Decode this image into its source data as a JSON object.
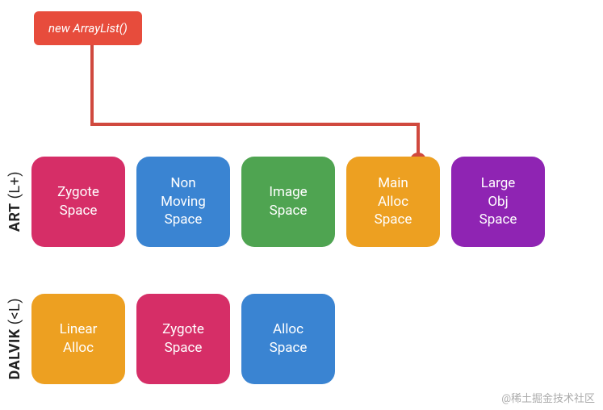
{
  "callout": {
    "text": "new ArrayList()"
  },
  "rows": {
    "art": {
      "label_main": "ART",
      "label_sub": "(L+)",
      "boxes": [
        {
          "label": "Zygote\nSpace",
          "color": "pink"
        },
        {
          "label": "Non\nMoving\nSpace",
          "color": "blue"
        },
        {
          "label": "Image\nSpace",
          "color": "green"
        },
        {
          "label": "Main\nAlloc\nSpace",
          "color": "orange"
        },
        {
          "label": "Large\nObj\nSpace",
          "color": "purple"
        }
      ]
    },
    "dalvik": {
      "label_main": "DALVIK",
      "label_sub": "(<L)",
      "boxes": [
        {
          "label": "Linear\nAlloc",
          "color": "orange"
        },
        {
          "label": "Zygote\nSpace",
          "color": "pink"
        },
        {
          "label": "Alloc\nSpace",
          "color": "blue"
        }
      ]
    }
  },
  "connector": {
    "target_box_index": 3
  },
  "watermark": "@稀土掘金技术社区"
}
